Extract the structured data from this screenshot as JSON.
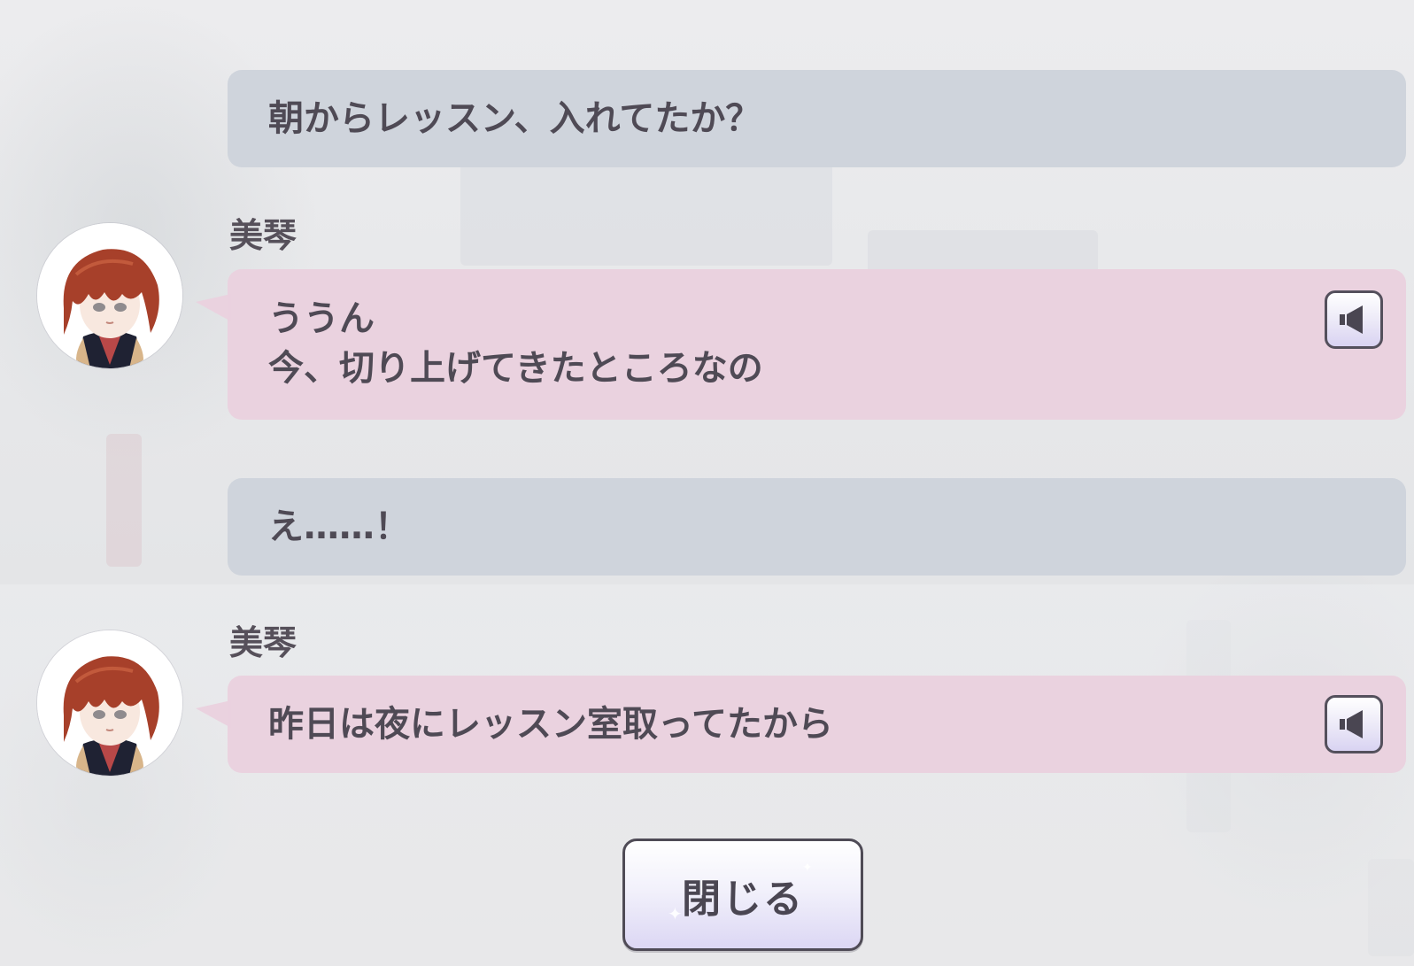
{
  "dialogue": [
    {
      "speaker": "",
      "type": "player",
      "lines": [
        "朝からレッスン、入れてたか？"
      ]
    },
    {
      "speaker": "美琴",
      "type": "npc",
      "lines": [
        "ううん",
        "今、切り上げてきたところなの"
      ],
      "voice_icon": "speaker-icon"
    },
    {
      "speaker": "",
      "type": "player",
      "lines": [
        "え……！"
      ]
    },
    {
      "speaker": "美琴",
      "type": "npc",
      "lines": [
        "昨日は夜にレッスン室取ってたから"
      ],
      "voice_icon": "speaker-icon"
    }
  ],
  "close_button": {
    "label": "閉じる"
  },
  "colors": {
    "player_bubble": "#cdd3db",
    "npc_bubble": "#ead1de",
    "text": "#4f4a55",
    "button_border": "#4f4b56"
  }
}
